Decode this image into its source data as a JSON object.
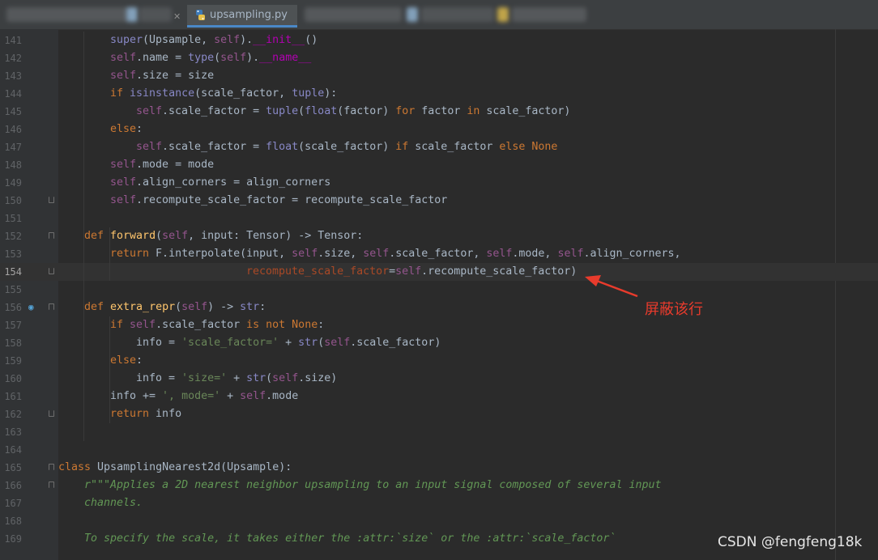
{
  "tabs": {
    "active_label": "upsampling.py"
  },
  "annotation": {
    "text": "屏蔽该行",
    "color": "#e83b2c"
  },
  "watermark": "CSDN @fengfeng18k",
  "editor": {
    "current_line": 154,
    "lines": [
      {
        "n": "141",
        "indent": 8,
        "tokens": [
          [
            "bi",
            "super"
          ],
          [
            "pl",
            "(Upsample, "
          ],
          [
            "sf",
            "self"
          ],
          [
            "pl",
            ")."
          ],
          [
            "mg",
            "__init__"
          ],
          [
            "pl",
            "()"
          ]
        ]
      },
      {
        "n": "142",
        "indent": 8,
        "tokens": [
          [
            "sf",
            "self"
          ],
          [
            "pl",
            ".name = "
          ],
          [
            "bi",
            "type"
          ],
          [
            "pl",
            "("
          ],
          [
            "sf",
            "self"
          ],
          [
            "pl",
            ")."
          ],
          [
            "mg",
            "__name__"
          ]
        ]
      },
      {
        "n": "143",
        "indent": 8,
        "tokens": [
          [
            "sf",
            "self"
          ],
          [
            "pl",
            ".size = size"
          ]
        ]
      },
      {
        "n": "144",
        "indent": 8,
        "tokens": [
          [
            "kw",
            "if "
          ],
          [
            "bi",
            "isinstance"
          ],
          [
            "pl",
            "(scale_factor, "
          ],
          [
            "bi",
            "tuple"
          ],
          [
            "pl",
            "):"
          ]
        ]
      },
      {
        "n": "145",
        "indent": 12,
        "tokens": [
          [
            "sf",
            "self"
          ],
          [
            "pl",
            ".scale_factor = "
          ],
          [
            "bi",
            "tuple"
          ],
          [
            "pl",
            "("
          ],
          [
            "bi",
            "float"
          ],
          [
            "pl",
            "(factor) "
          ],
          [
            "kw",
            "for"
          ],
          [
            "pl",
            " factor "
          ],
          [
            "kw",
            "in"
          ],
          [
            "pl",
            " scale_factor)"
          ]
        ]
      },
      {
        "n": "146",
        "indent": 8,
        "tokens": [
          [
            "kw",
            "else"
          ],
          [
            "pl",
            ":"
          ]
        ]
      },
      {
        "n": "147",
        "indent": 12,
        "tokens": [
          [
            "sf",
            "self"
          ],
          [
            "pl",
            ".scale_factor = "
          ],
          [
            "bi",
            "float"
          ],
          [
            "pl",
            "(scale_factor) "
          ],
          [
            "kw",
            "if"
          ],
          [
            "pl",
            " scale_factor "
          ],
          [
            "kw",
            "else"
          ],
          [
            "pl",
            " "
          ],
          [
            "kw",
            "None"
          ]
        ]
      },
      {
        "n": "148",
        "indent": 8,
        "tokens": [
          [
            "sf",
            "self"
          ],
          [
            "pl",
            ".mode = mode"
          ]
        ]
      },
      {
        "n": "149",
        "indent": 8,
        "tokens": [
          [
            "sf",
            "self"
          ],
          [
            "pl",
            ".align_corners = align_corners"
          ]
        ]
      },
      {
        "n": "150",
        "indent": 8,
        "fold": "up",
        "tokens": [
          [
            "sf",
            "self"
          ],
          [
            "pl",
            ".recompute_scale_factor = recompute_scale_factor"
          ]
        ]
      },
      {
        "n": "151",
        "indent": 0,
        "tokens": []
      },
      {
        "n": "152",
        "indent": 4,
        "fold": "dn",
        "tokens": [
          [
            "kw",
            "def "
          ],
          [
            "fn",
            "forward"
          ],
          [
            "pl",
            "("
          ],
          [
            "sf",
            "self"
          ],
          [
            "pl",
            ", input: Tensor) -> Tensor:"
          ]
        ]
      },
      {
        "n": "153",
        "indent": 8,
        "tokens": [
          [
            "kw",
            "return"
          ],
          [
            "pl",
            " F.interpolate(input, "
          ],
          [
            "sf",
            "self"
          ],
          [
            "pl",
            ".size, "
          ],
          [
            "sf",
            "self"
          ],
          [
            "pl",
            ".scale_factor, "
          ],
          [
            "sf",
            "self"
          ],
          [
            "pl",
            ".mode, "
          ],
          [
            "sf",
            "self"
          ],
          [
            "pl",
            ".align_corners,"
          ]
        ]
      },
      {
        "n": "154",
        "indent": 29,
        "fold": "up",
        "tokens": [
          [
            "kwa",
            "recompute_scale_factor"
          ],
          [
            "pl",
            "="
          ],
          [
            "sf",
            "self"
          ],
          [
            "pl",
            ".recompute_scale_factor)"
          ]
        ]
      },
      {
        "n": "155",
        "indent": 0,
        "tokens": []
      },
      {
        "n": "156",
        "indent": 4,
        "fold": "dn",
        "marker": true,
        "tokens": [
          [
            "kw",
            "def "
          ],
          [
            "fn",
            "extra_repr"
          ],
          [
            "pl",
            "("
          ],
          [
            "sf",
            "self"
          ],
          [
            "pl",
            ") -> "
          ],
          [
            "bi",
            "str"
          ],
          [
            "pl",
            ":"
          ]
        ]
      },
      {
        "n": "157",
        "indent": 8,
        "tokens": [
          [
            "kw",
            "if "
          ],
          [
            "sf",
            "self"
          ],
          [
            "pl",
            ".scale_factor "
          ],
          [
            "kw",
            "is not None"
          ],
          [
            "pl",
            ":"
          ]
        ]
      },
      {
        "n": "158",
        "indent": 12,
        "tokens": [
          [
            "pl",
            "info = "
          ],
          [
            "st",
            "'scale_factor='"
          ],
          [
            "pl",
            " + "
          ],
          [
            "bi",
            "str"
          ],
          [
            "pl",
            "("
          ],
          [
            "sf",
            "self"
          ],
          [
            "pl",
            ".scale_factor)"
          ]
        ]
      },
      {
        "n": "159",
        "indent": 8,
        "tokens": [
          [
            "kw",
            "else"
          ],
          [
            "pl",
            ":"
          ]
        ]
      },
      {
        "n": "160",
        "indent": 12,
        "tokens": [
          [
            "pl",
            "info = "
          ],
          [
            "st",
            "'size='"
          ],
          [
            "pl",
            " + "
          ],
          [
            "bi",
            "str"
          ],
          [
            "pl",
            "("
          ],
          [
            "sf",
            "self"
          ],
          [
            "pl",
            ".size)"
          ]
        ]
      },
      {
        "n": "161",
        "indent": 8,
        "tokens": [
          [
            "pl",
            "info += "
          ],
          [
            "st",
            "', mode='"
          ],
          [
            "pl",
            " + "
          ],
          [
            "sf",
            "self"
          ],
          [
            "pl",
            ".mode"
          ]
        ]
      },
      {
        "n": "162",
        "indent": 8,
        "fold": "up",
        "tokens": [
          [
            "kw",
            "return"
          ],
          [
            "pl",
            " info"
          ]
        ]
      },
      {
        "n": "163",
        "indent": 0,
        "tokens": []
      },
      {
        "n": "164",
        "indent": 0,
        "tokens": []
      },
      {
        "n": "165",
        "indent": 0,
        "fold": "dn",
        "tokens": [
          [
            "kw",
            "class "
          ],
          [
            "pl",
            "UpsamplingNearest2d(Upsample):"
          ]
        ]
      },
      {
        "n": "166",
        "indent": 4,
        "fold": "dn",
        "tokens": [
          [
            "ds",
            "r\"\"\"Applies a 2D nearest neighbor upsampling to an input signal composed of several input"
          ]
        ]
      },
      {
        "n": "167",
        "indent": 4,
        "tokens": [
          [
            "ds",
            "channels."
          ]
        ]
      },
      {
        "n": "168",
        "indent": 0,
        "tokens": []
      },
      {
        "n": "169",
        "indent": 4,
        "tokens": [
          [
            "ds",
            "To specify the scale, it takes either the :attr:`size` or the :attr:`scale_factor`"
          ]
        ]
      }
    ]
  }
}
